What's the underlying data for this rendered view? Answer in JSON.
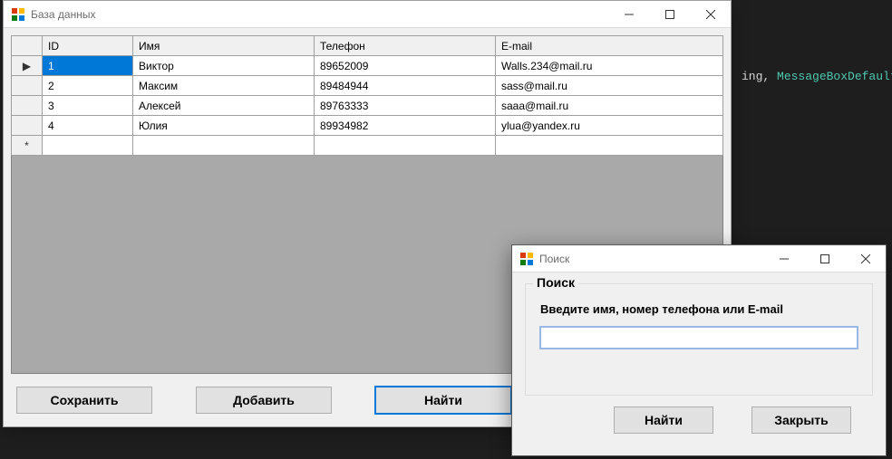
{
  "bg_code": {
    "prefix": "ing, ",
    "type": "MessageBoxDefaultButt"
  },
  "main_window": {
    "title": "База данных",
    "columns": {
      "id": "ID",
      "name": "Имя",
      "phone": "Телефон",
      "email": "E-mail"
    },
    "rows": [
      {
        "id": "1",
        "name": "Виктор",
        "phone": "89652009",
        "email": "Walls.234@mail.ru"
      },
      {
        "id": "2",
        "name": "Максим",
        "phone": "89484944",
        "email": "sass@mail.ru"
      },
      {
        "id": "3",
        "name": "Алексей",
        "phone": "89763333",
        "email": "saaa@mail.ru"
      },
      {
        "id": "4",
        "name": "Юлия",
        "phone": "89934982",
        "email": "ylua@yandex.ru"
      }
    ],
    "row_indicator_current": "▶",
    "row_indicator_new": "*",
    "buttons": {
      "save": "Сохранить",
      "add": "Добавить",
      "find": "Найти"
    }
  },
  "search_dialog": {
    "title": "Поиск",
    "group_title": "Поиск",
    "prompt": "Введите имя, номер телефона или E-mail",
    "input_value": "",
    "buttons": {
      "find": "Найти",
      "close": "Закрыть"
    }
  }
}
